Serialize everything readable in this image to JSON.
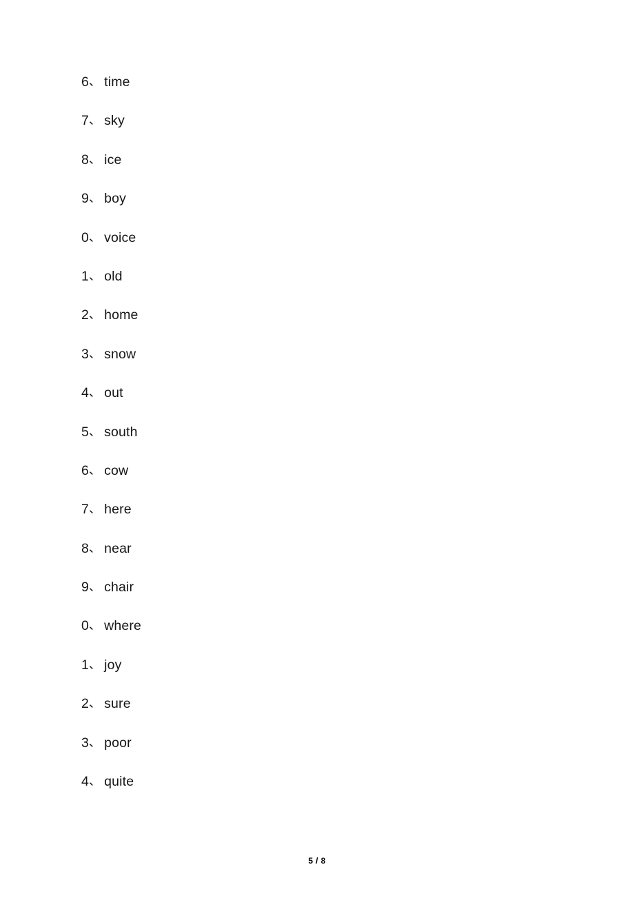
{
  "document": {
    "page_background": "#ffffff",
    "text_color": "#161616",
    "enumeration_mark": "、",
    "word_list": [
      {
        "index": "6",
        "mark": "、",
        "word": "time"
      },
      {
        "index": "7",
        "mark": "、",
        "word": "sky"
      },
      {
        "index": "8",
        "mark": "、",
        "word": "ice"
      },
      {
        "index": "9",
        "mark": "、",
        "word": "boy"
      },
      {
        "index": "0",
        "mark": "、",
        "word": "voice"
      },
      {
        "index": "1",
        "mark": "、",
        "word": "old"
      },
      {
        "index": "2",
        "mark": "、",
        "word": "home"
      },
      {
        "index": "3",
        "mark": "、",
        "word": "snow"
      },
      {
        "index": "4",
        "mark": "、",
        "word": "out"
      },
      {
        "index": "5",
        "mark": "、",
        "word": "south"
      },
      {
        "index": "6",
        "mark": "、",
        "word": "cow"
      },
      {
        "index": "7",
        "mark": "、",
        "word": "here"
      },
      {
        "index": "8",
        "mark": "、",
        "word": "near"
      },
      {
        "index": "9",
        "mark": "、",
        "word": "chair"
      },
      {
        "index": "0",
        "mark": "、",
        "word": "where"
      },
      {
        "index": "1",
        "mark": "、",
        "word": "joy"
      },
      {
        "index": "2",
        "mark": "、",
        "word": "sure"
      },
      {
        "index": "3",
        "mark": "、",
        "word": "poor"
      },
      {
        "index": "4",
        "mark": "、",
        "word": "quite"
      }
    ]
  },
  "footer": {
    "page_number": "5 / 8",
    "current_page": "5",
    "total_pages": "8"
  }
}
